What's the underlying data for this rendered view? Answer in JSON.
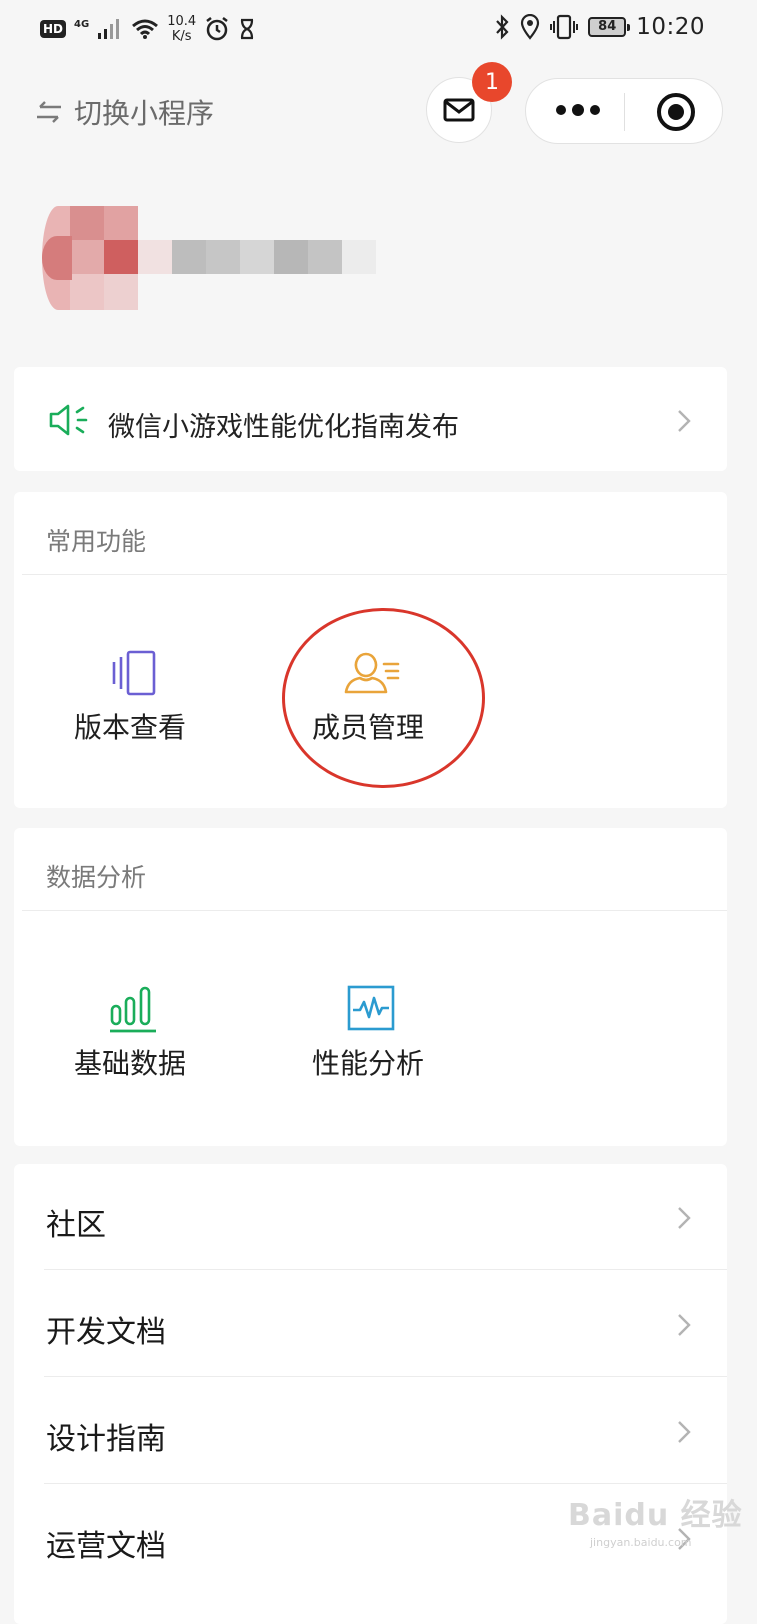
{
  "status_bar": {
    "hd": "HD",
    "network": "4G",
    "speed_value": "10.4",
    "speed_unit": "K/s",
    "battery": "84",
    "time": "10:20"
  },
  "header": {
    "switch_label": "切换小程序",
    "mail_badge_count": "1"
  },
  "notice": {
    "text": "微信小游戏性能优化指南发布"
  },
  "common": {
    "title": "常用功能",
    "items": [
      {
        "label": "版本查看",
        "icon": "version-icon",
        "color": "#6b5fd3"
      },
      {
        "label": "成员管理",
        "icon": "member-icon",
        "color": "#e9a43a"
      }
    ]
  },
  "data_analysis": {
    "title": "数据分析",
    "items": [
      {
        "label": "基础数据",
        "icon": "bar-chart-icon",
        "color": "#1aad5a"
      },
      {
        "label": "性能分析",
        "icon": "performance-icon",
        "color": "#2b9bd0"
      }
    ]
  },
  "list": {
    "items": [
      {
        "label": "社区"
      },
      {
        "label": "开发文档"
      },
      {
        "label": "设计指南"
      },
      {
        "label": "运营文档"
      }
    ]
  },
  "watermark": {
    "brand": "Baidu 经验",
    "site": "jingyan.baidu.com"
  },
  "colors": {
    "highlight_circle": "#d9362b",
    "badge": "#e8472c",
    "notice_icon": "#1aad5a"
  }
}
